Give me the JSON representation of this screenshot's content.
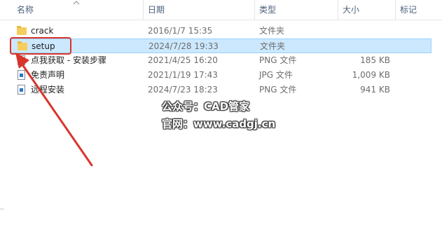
{
  "columns": {
    "name": "名称",
    "date": "日期",
    "type": "类型",
    "size": "大小",
    "tags": "标记"
  },
  "files": [
    {
      "name": "crack",
      "date": "2016/1/7 15:35",
      "type": "文件夹",
      "size": "",
      "icon": "folder-icon",
      "selected": false
    },
    {
      "name": "setup",
      "date": "2024/7/28 19:33",
      "type": "文件夹",
      "size": "",
      "icon": "folder-icon",
      "selected": true
    },
    {
      "name": "点我获取 - 安装步骤",
      "date": "2021/4/25 16:20",
      "type": "PNG 文件",
      "size": "185 KB",
      "icon": "image-file-icon",
      "selected": false
    },
    {
      "name": "免责声明",
      "date": "2021/1/19 17:43",
      "type": "JPG 文件",
      "size": "1,009 KB",
      "icon": "image-file-icon",
      "selected": false
    },
    {
      "name": "远程安装",
      "date": "2024/7/23 18:23",
      "type": "PNG 文件",
      "size": "941 KB",
      "icon": "image-file-icon",
      "selected": false
    }
  ],
  "watermark": {
    "line1": "公众号：CAD管家",
    "line2": "官网：www.cadgj.cn"
  },
  "annotation": {
    "color": "#d9342b"
  }
}
